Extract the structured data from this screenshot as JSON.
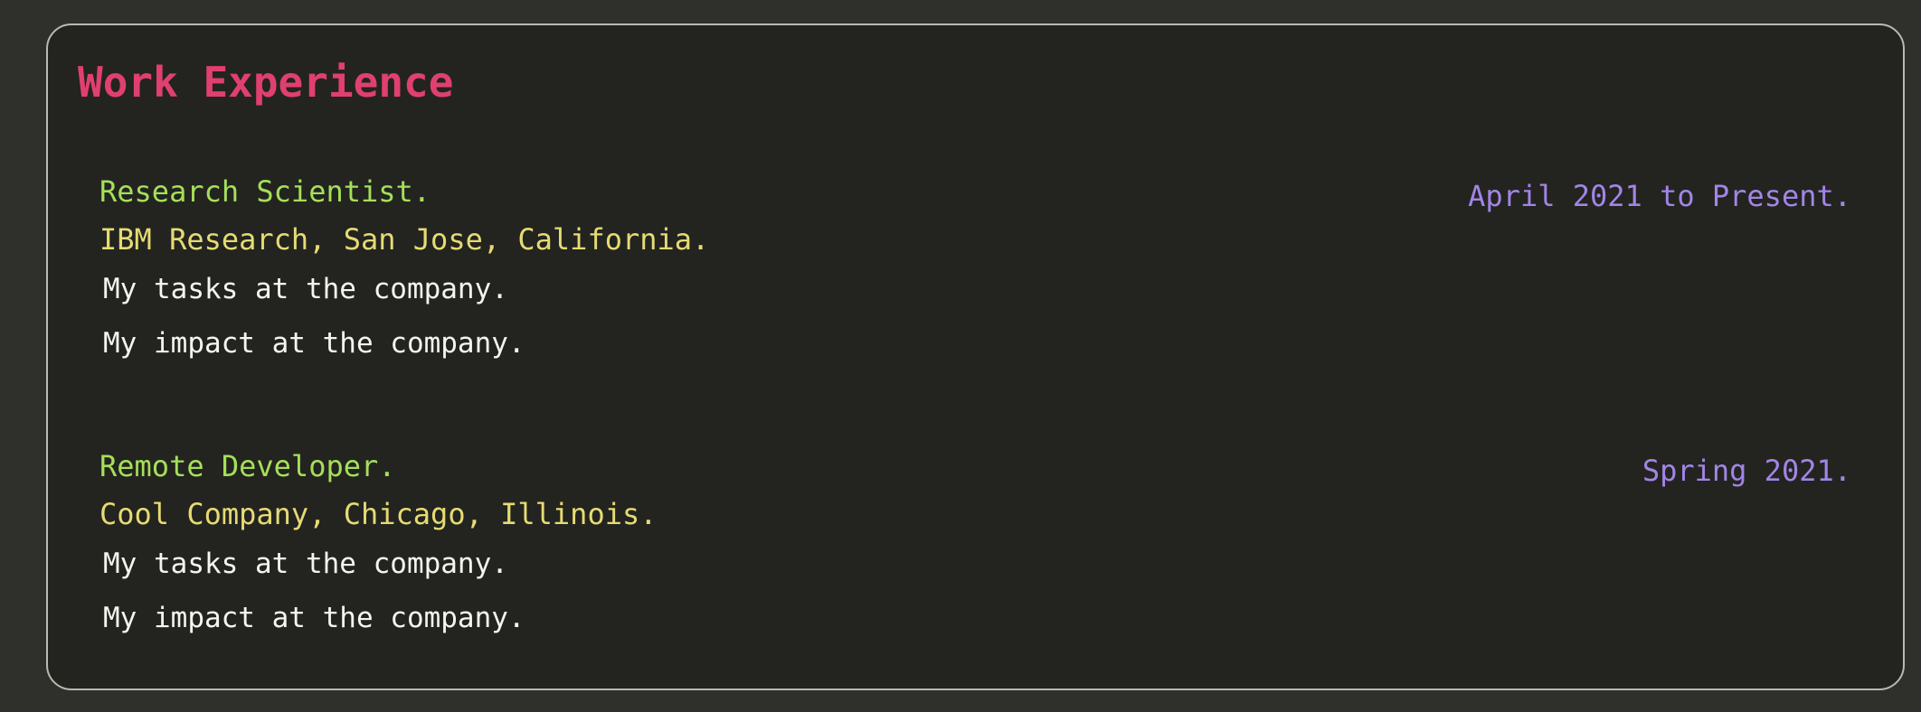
{
  "section": {
    "title": "Work Experience"
  },
  "jobs": [
    {
      "title": "Research Scientist.",
      "organization": "IBM Research, San Jose, California.",
      "tasks": "My tasks at the company.",
      "impact": "My impact at the company.",
      "dates": "April 2021 to Present."
    },
    {
      "title": "Remote Developer.",
      "organization": "Cool Company, Chicago, Illinois.",
      "tasks": "My tasks at the company.",
      "impact": "My impact at the company.",
      "dates": "Spring 2021."
    }
  ],
  "colors": {
    "page_background": "#2f302b",
    "card_background": "#23241f",
    "card_border": "#b9b9b0",
    "title": "#e0406f",
    "job_title": "#a6df5a",
    "organization": "#e6db74",
    "body_text": "#f5f5f0",
    "dates": "#a285e7"
  }
}
